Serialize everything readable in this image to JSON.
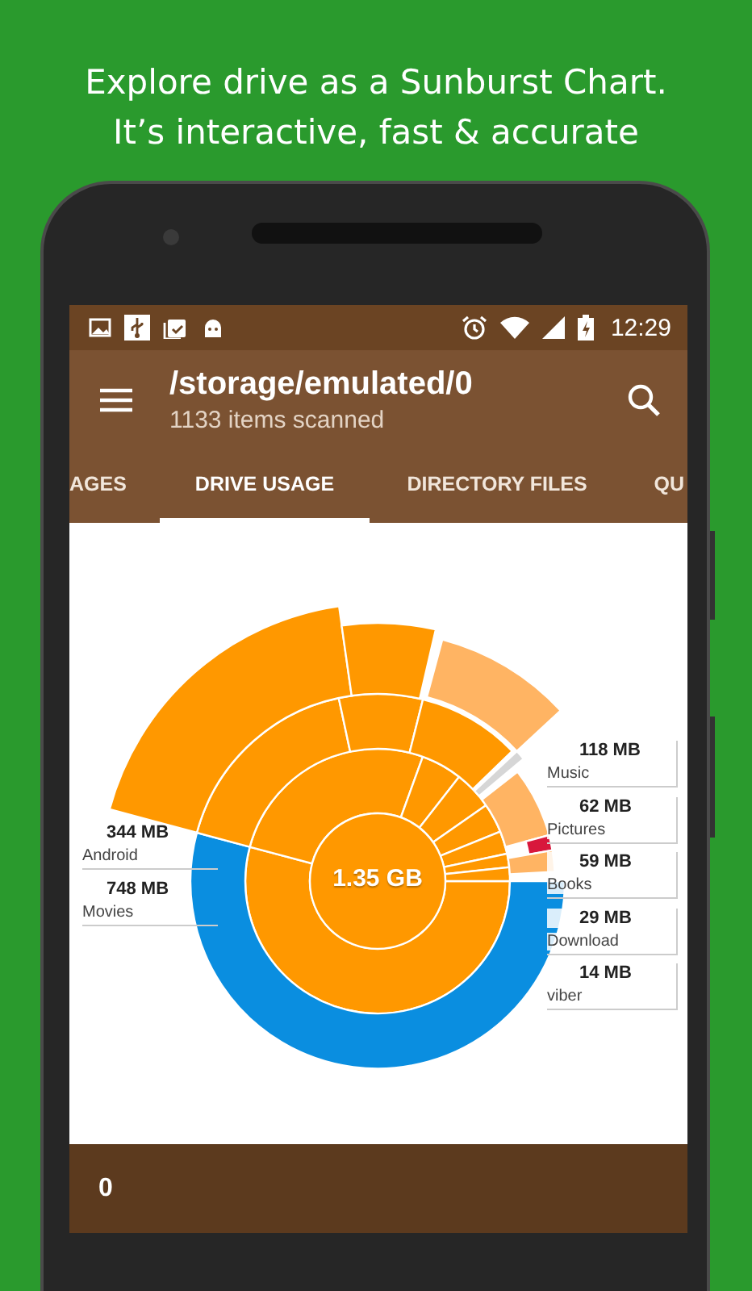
{
  "headline": [
    "Explore drive as a Sunburst Chart.",
    "It’s interactive, fast & accurate"
  ],
  "status_bar": {
    "time": "12:29"
  },
  "toolbar": {
    "title": "/storage/emulated/0",
    "subtitle": "1133 items scanned"
  },
  "tabs": [
    {
      "label": "AGES",
      "selected": false
    },
    {
      "label": "DRIVE USAGE",
      "selected": true
    },
    {
      "label": "DIRECTORY FILES",
      "selected": false
    },
    {
      "label": "QU",
      "selected": false
    }
  ],
  "chart": {
    "center_label": "1.35 GB",
    "labels": [
      {
        "kind": "left",
        "size": "344 MB",
        "name": "Android"
      },
      {
        "kind": "left",
        "size": "748 MB",
        "name": "Movies"
      },
      {
        "kind": "right",
        "size": "118 MB",
        "name": "Music"
      },
      {
        "kind": "right",
        "size": "62 MB",
        "name": "Pictures"
      },
      {
        "kind": "right",
        "size": "59 MB",
        "name": "Books"
      },
      {
        "kind": "right",
        "size": "29 MB",
        "name": "Download"
      },
      {
        "kind": "right",
        "size": "14 MB",
        "name": "viber"
      }
    ]
  },
  "bottom_bar": {
    "count": "0"
  }
}
